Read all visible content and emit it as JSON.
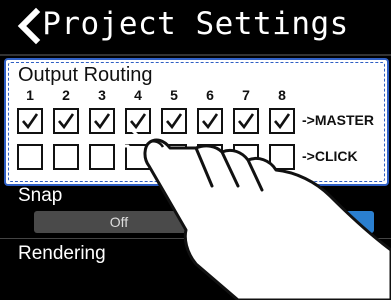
{
  "header": {
    "title": "Project Settings",
    "back_icon": "chevron-left-icon"
  },
  "routing": {
    "label": "Output Routing",
    "channels": [
      "1",
      "2",
      "3",
      "4",
      "5",
      "6",
      "7",
      "8"
    ],
    "master_label": "->MASTER",
    "click_label": "->CLICK",
    "master_checked": [
      true,
      true,
      true,
      true,
      true,
      true,
      true,
      true
    ],
    "click_checked": [
      false,
      false,
      false,
      false,
      false,
      false,
      false,
      false
    ]
  },
  "snap": {
    "label": "Snap",
    "value": "Off"
  },
  "rendering": {
    "label": "Rendering",
    "chevron": ">"
  },
  "colors": {
    "accent": "#2f5fc4",
    "toggle_on": "#2a7fd0"
  }
}
